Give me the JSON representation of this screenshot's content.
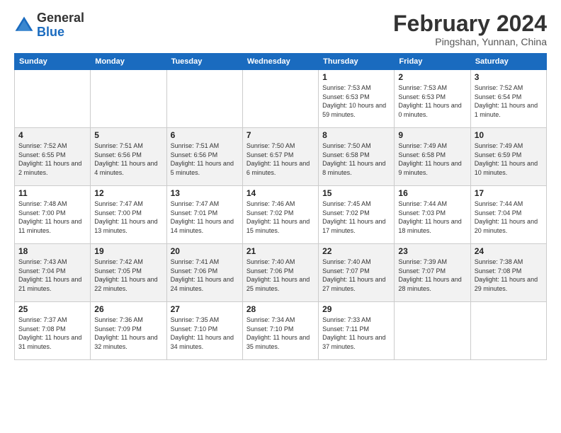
{
  "logo": {
    "general": "General",
    "blue": "Blue"
  },
  "title": "February 2024",
  "subtitle": "Pingshan, Yunnan, China",
  "days_of_week": [
    "Sunday",
    "Monday",
    "Tuesday",
    "Wednesday",
    "Thursday",
    "Friday",
    "Saturday"
  ],
  "weeks": [
    [
      {
        "day": "",
        "info": ""
      },
      {
        "day": "",
        "info": ""
      },
      {
        "day": "",
        "info": ""
      },
      {
        "day": "",
        "info": ""
      },
      {
        "day": "1",
        "info": "Sunrise: 7:53 AM\nSunset: 6:53 PM\nDaylight: 10 hours and 59 minutes."
      },
      {
        "day": "2",
        "info": "Sunrise: 7:53 AM\nSunset: 6:53 PM\nDaylight: 11 hours and 0 minutes."
      },
      {
        "day": "3",
        "info": "Sunrise: 7:52 AM\nSunset: 6:54 PM\nDaylight: 11 hours and 1 minute."
      }
    ],
    [
      {
        "day": "4",
        "info": "Sunrise: 7:52 AM\nSunset: 6:55 PM\nDaylight: 11 hours and 2 minutes."
      },
      {
        "day": "5",
        "info": "Sunrise: 7:51 AM\nSunset: 6:56 PM\nDaylight: 11 hours and 4 minutes."
      },
      {
        "day": "6",
        "info": "Sunrise: 7:51 AM\nSunset: 6:56 PM\nDaylight: 11 hours and 5 minutes."
      },
      {
        "day": "7",
        "info": "Sunrise: 7:50 AM\nSunset: 6:57 PM\nDaylight: 11 hours and 6 minutes."
      },
      {
        "day": "8",
        "info": "Sunrise: 7:50 AM\nSunset: 6:58 PM\nDaylight: 11 hours and 8 minutes."
      },
      {
        "day": "9",
        "info": "Sunrise: 7:49 AM\nSunset: 6:58 PM\nDaylight: 11 hours and 9 minutes."
      },
      {
        "day": "10",
        "info": "Sunrise: 7:49 AM\nSunset: 6:59 PM\nDaylight: 11 hours and 10 minutes."
      }
    ],
    [
      {
        "day": "11",
        "info": "Sunrise: 7:48 AM\nSunset: 7:00 PM\nDaylight: 11 hours and 11 minutes."
      },
      {
        "day": "12",
        "info": "Sunrise: 7:47 AM\nSunset: 7:00 PM\nDaylight: 11 hours and 13 minutes."
      },
      {
        "day": "13",
        "info": "Sunrise: 7:47 AM\nSunset: 7:01 PM\nDaylight: 11 hours and 14 minutes."
      },
      {
        "day": "14",
        "info": "Sunrise: 7:46 AM\nSunset: 7:02 PM\nDaylight: 11 hours and 15 minutes."
      },
      {
        "day": "15",
        "info": "Sunrise: 7:45 AM\nSunset: 7:02 PM\nDaylight: 11 hours and 17 minutes."
      },
      {
        "day": "16",
        "info": "Sunrise: 7:44 AM\nSunset: 7:03 PM\nDaylight: 11 hours and 18 minutes."
      },
      {
        "day": "17",
        "info": "Sunrise: 7:44 AM\nSunset: 7:04 PM\nDaylight: 11 hours and 20 minutes."
      }
    ],
    [
      {
        "day": "18",
        "info": "Sunrise: 7:43 AM\nSunset: 7:04 PM\nDaylight: 11 hours and 21 minutes."
      },
      {
        "day": "19",
        "info": "Sunrise: 7:42 AM\nSunset: 7:05 PM\nDaylight: 11 hours and 22 minutes."
      },
      {
        "day": "20",
        "info": "Sunrise: 7:41 AM\nSunset: 7:06 PM\nDaylight: 11 hours and 24 minutes."
      },
      {
        "day": "21",
        "info": "Sunrise: 7:40 AM\nSunset: 7:06 PM\nDaylight: 11 hours and 25 minutes."
      },
      {
        "day": "22",
        "info": "Sunrise: 7:40 AM\nSunset: 7:07 PM\nDaylight: 11 hours and 27 minutes."
      },
      {
        "day": "23",
        "info": "Sunrise: 7:39 AM\nSunset: 7:07 PM\nDaylight: 11 hours and 28 minutes."
      },
      {
        "day": "24",
        "info": "Sunrise: 7:38 AM\nSunset: 7:08 PM\nDaylight: 11 hours and 29 minutes."
      }
    ],
    [
      {
        "day": "25",
        "info": "Sunrise: 7:37 AM\nSunset: 7:08 PM\nDaylight: 11 hours and 31 minutes."
      },
      {
        "day": "26",
        "info": "Sunrise: 7:36 AM\nSunset: 7:09 PM\nDaylight: 11 hours and 32 minutes."
      },
      {
        "day": "27",
        "info": "Sunrise: 7:35 AM\nSunset: 7:10 PM\nDaylight: 11 hours and 34 minutes."
      },
      {
        "day": "28",
        "info": "Sunrise: 7:34 AM\nSunset: 7:10 PM\nDaylight: 11 hours and 35 minutes."
      },
      {
        "day": "29",
        "info": "Sunrise: 7:33 AM\nSunset: 7:11 PM\nDaylight: 11 hours and 37 minutes."
      },
      {
        "day": "",
        "info": ""
      },
      {
        "day": "",
        "info": ""
      }
    ]
  ]
}
